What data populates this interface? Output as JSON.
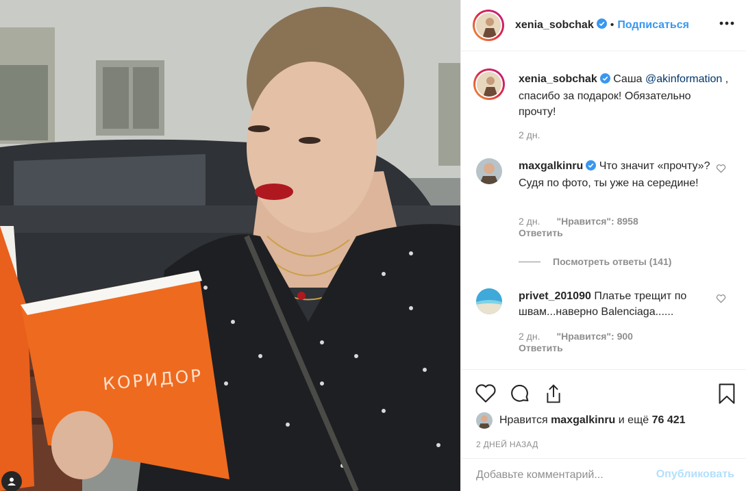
{
  "post": {
    "author": "xenia_sobchak",
    "follow_label": "Подписаться",
    "dot": "•",
    "more_icon": "more-horizontal-icon",
    "book_title": "КОРИДОР"
  },
  "caption": {
    "author": "xenia_sobchak",
    "text_start": "Саша",
    "mention": "@akinformation",
    "text_end": ", спасибо за подарок! Обязательно прочту!",
    "time": "2 дн."
  },
  "comments": [
    {
      "author": "maxgalkinru",
      "verified": true,
      "text": "Что значит «прочту»? Судя по фото, ты уже на середине!",
      "time": "2 дн.",
      "likes": "\"Нравится\": 8958",
      "reply": "Ответить",
      "view_replies": "Посмотреть ответы (141)"
    },
    {
      "author": "privet_201090",
      "verified": false,
      "text": "Платье трещит по швам...наверно Balenciaga......",
      "time": "2 дн.",
      "likes": "\"Нравится\": 900",
      "reply": "Ответить"
    }
  ],
  "actions": {
    "likes_prefix": "Нравится",
    "likes_user": "maxgalkinru",
    "likes_and": "и ещё",
    "likes_count": "76 421",
    "time_ago": "2 ДНЕЙ НАЗАД"
  },
  "add_comment": {
    "placeholder": "Добавьте комментарий...",
    "publish_label": "Опубликовать"
  },
  "colors": {
    "link_blue": "#3897f0",
    "mention_blue": "#003569",
    "muted": "#8e8e8e",
    "publish_disabled": "#b2dffc"
  }
}
